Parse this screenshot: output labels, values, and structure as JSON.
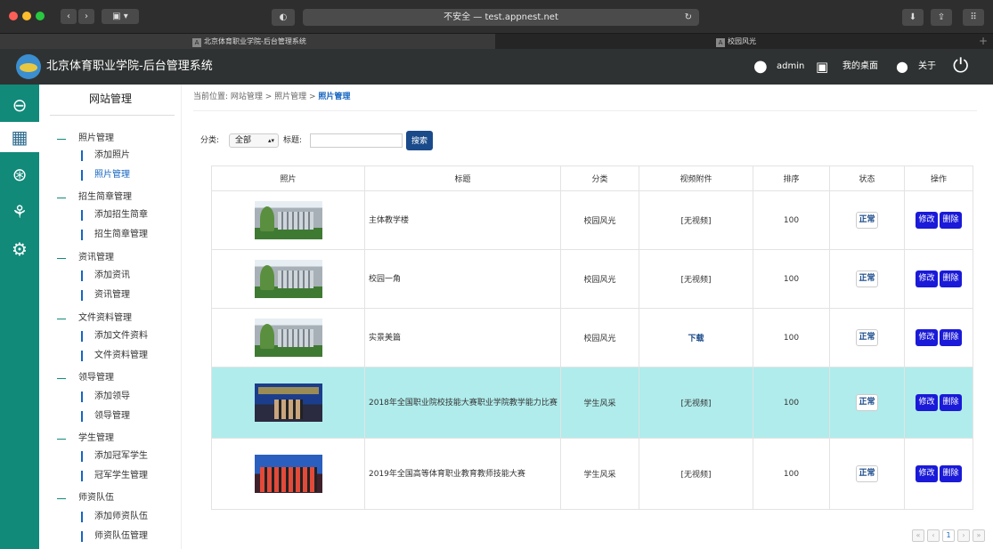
{
  "browser": {
    "address": "不安全 — test.appnest.net",
    "tabs": [
      {
        "favicon": "A",
        "label": "北京体育职业学院-后台管理系统"
      },
      {
        "favicon": "A",
        "label": "校园风光"
      }
    ]
  },
  "header": {
    "title": "北京体育职业学院-后台管理系统",
    "user": "admin",
    "desktop": "我的桌面",
    "about": "关于"
  },
  "sidebar": {
    "title": "网站管理",
    "groups": [
      {
        "label": "照片管理",
        "children": [
          "添加照片",
          "照片管理"
        ]
      },
      {
        "label": "招生简章管理",
        "children": [
          "添加招生简章",
          "招生简章管理"
        ]
      },
      {
        "label": "资讯管理",
        "children": [
          "添加资讯",
          "资讯管理"
        ]
      },
      {
        "label": "文件资料管理",
        "children": [
          "添加文件资料",
          "文件资料管理"
        ]
      },
      {
        "label": "领导管理",
        "children": [
          "添加领导",
          "领导管理"
        ]
      },
      {
        "label": "学生管理",
        "children": [
          "添加冠军学生",
          "冠军学生管理"
        ]
      },
      {
        "label": "师资队伍",
        "children": [
          "添加师资队伍",
          "师资队伍管理"
        ]
      }
    ]
  },
  "breadcrumb": {
    "prefix": "当前位置: 网站管理 > 照片管理 > ",
    "current": "照片管理"
  },
  "filter": {
    "category_label": "分类:",
    "category_value": "全部",
    "title_label": "标题:",
    "title_value": "",
    "search_label": "搜索"
  },
  "table": {
    "columns": [
      "照片",
      "标题",
      "分类",
      "视频附件",
      "排序",
      "状态",
      "操作"
    ],
    "rows": [
      {
        "title": "主体教学楼",
        "category": "校园风光",
        "attachment": "[无视频]",
        "order": "100",
        "status": "正常"
      },
      {
        "title": "校园一角",
        "category": "校园风光",
        "attachment": "[无视频]",
        "order": "100",
        "status": "正常"
      },
      {
        "title": "实景美篇",
        "category": "校园风光",
        "attachment": "下载",
        "order": "100",
        "status": "正常"
      },
      {
        "title": "2018年全国职业院校技能大赛职业学院教学能力比赛",
        "category": "学生风采",
        "attachment": "[无视频]",
        "order": "100",
        "status": "正常"
      },
      {
        "title": "2019年全国高等体育职业教育教师技能大赛",
        "category": "学生风采",
        "attachment": "[无视频]",
        "order": "100",
        "status": "正常"
      }
    ],
    "edit_label": "修改",
    "delete_label": "删除"
  },
  "pagination": {
    "first": "«",
    "prev": "‹",
    "current": "1",
    "next": "›",
    "last": "»"
  }
}
